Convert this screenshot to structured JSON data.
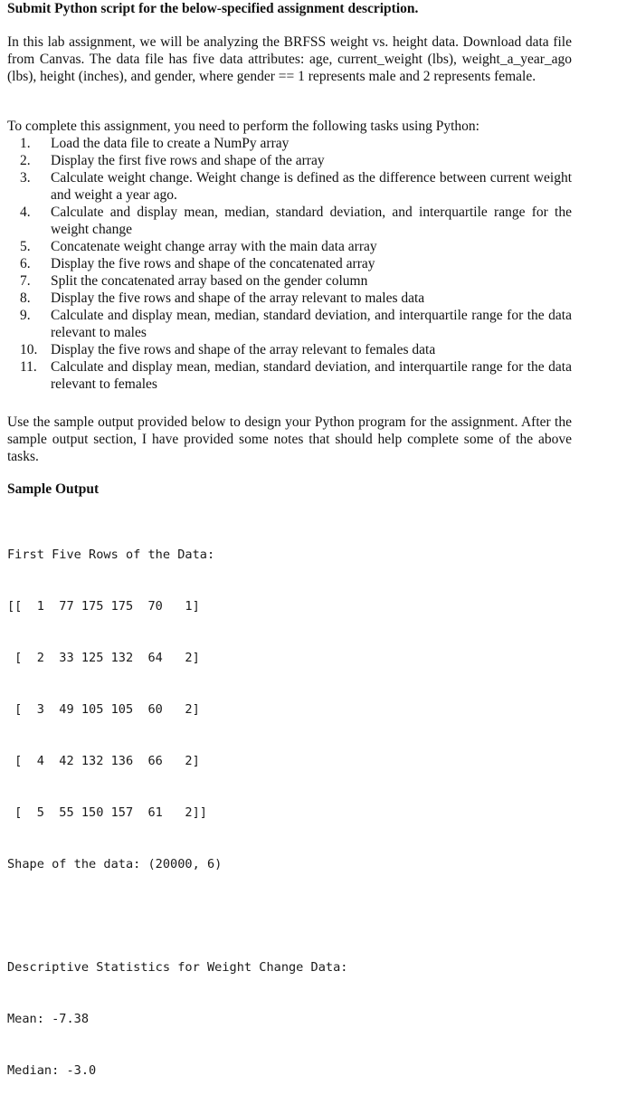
{
  "document": {
    "title": "Submit Python script for the below-specified assignment description.",
    "intro_paragraph": "In this lab assignment, we will be analyzing the BRFSS weight vs. height data. Download data file from Canvas. The data file has five data attributes: age, current_weight (lbs), weight_a_year_ago (lbs), height (inches), and gender, where gender == 1 represents male and 2 represents female.",
    "tasks_intro": "To complete this assignment, you need to perform the following tasks using Python:",
    "tasks": [
      {
        "num": "1.",
        "text": "Load the data file to create a NumPy array"
      },
      {
        "num": "2.",
        "text": "Display the first five rows and shape of the array"
      },
      {
        "num": "3.",
        "text": "Calculate weight change. Weight change is defined as the difference between current weight and weight a year ago."
      },
      {
        "num": "4.",
        "text": "Calculate and display mean, median, standard deviation, and interquartile range for the weight change"
      },
      {
        "num": "5.",
        "text": "Concatenate weight change array with the main data array"
      },
      {
        "num": "6.",
        "text": "Display the five rows and shape of the concatenated array"
      },
      {
        "num": "7.",
        "text": "Split the concatenated array based on the gender column"
      },
      {
        "num": "8.",
        "text": "Display the five rows and shape of the array relevant to males data"
      },
      {
        "num": "9.",
        "text": "Calculate and display mean, median, standard deviation, and interquartile range for the data relevant to males"
      },
      {
        "num": "10.",
        "text": "Display the five rows and shape of the array relevant to females data"
      },
      {
        "num": "11.",
        "text": "Calculate and display mean, median, standard deviation, and interquartile range for the data relevant to females"
      }
    ],
    "sample_note": "Use the sample output provided below to design your Python program for the assignment. After the sample output section, I have provided some notes that should help complete some of the above tasks.",
    "sample_heading": "Sample Output"
  },
  "console": {
    "data_header": "First Five Rows of the Data:",
    "rows": [
      "[[  1  77 175 175  70   1]",
      " [  2  33 125 132  64   2]",
      " [  3  49 105 105  60   2]",
      " [  4  42 132 136  66   2]",
      " [  5  55 150 157  61   2]]"
    ],
    "shape_line": "Shape of the data: (20000, 6)",
    "stats_header": "Descriptive Statistics for Weight Change Data:",
    "mean_line": "Mean: -7.38",
    "median_line": "Median: -3.0"
  }
}
